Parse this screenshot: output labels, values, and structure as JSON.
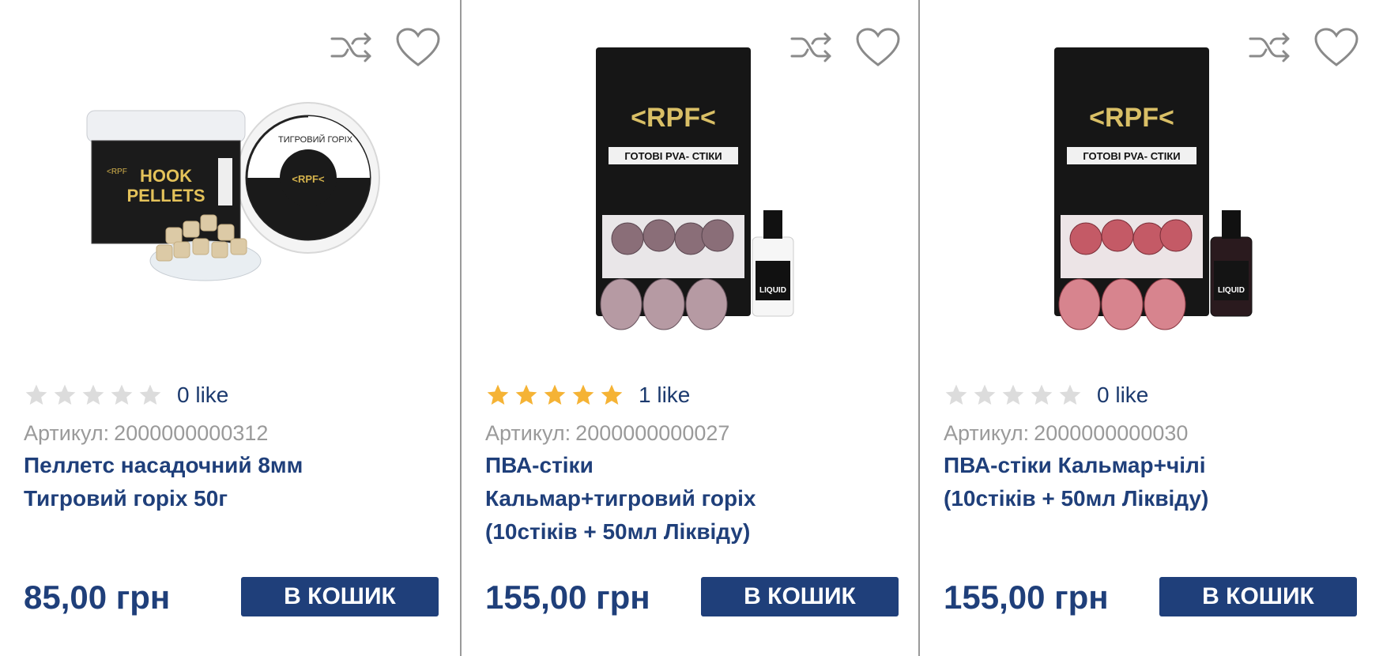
{
  "colors": {
    "brand_blue": "#1f3f7a",
    "star_filled": "#f5b335",
    "star_empty": "#dcdcdc",
    "muted_text": "#9a9a9a"
  },
  "products": [
    {
      "rating": 0,
      "likes": "0 like",
      "sku_label": "Артикул:",
      "sku": "2000000000312",
      "title_lines": [
        "Пеллетс насадочний 8мм",
        "Тигровий горіх 50г"
      ],
      "price": "85,00 грн",
      "buy_label": "В КОШИК",
      "image_labels": {
        "jar_text": "HOOK PELLETS",
        "lid_text": "ТИГРОВИЙ ГОРІХ"
      }
    },
    {
      "rating": 5,
      "likes": "1 like",
      "sku_label": "Артикул:",
      "sku": "2000000000027",
      "title_lines": [
        "ПВА-стіки",
        "Кальмар+тигровий горіх",
        "(10стіків + 50мл Ліквіду)"
      ],
      "price": "155,00 грн",
      "buy_label": "В КОШИК",
      "image_labels": {
        "brand": "<RPF<",
        "bag_text": "ГОТОВІ PVA- СТІКИ",
        "bottle_text": "LIQUID"
      }
    },
    {
      "rating": 0,
      "likes": "0 like",
      "sku_label": "Артикул:",
      "sku": "2000000000030",
      "title_lines": [
        "ПВА-стіки Кальмар+чілі",
        "(10стіків + 50мл Ліквіду)"
      ],
      "price": "155,00 грн",
      "buy_label": "В КОШИК",
      "image_labels": {
        "brand": "<RPF<",
        "bag_text": "ГОТОВІ PVA- СТІКИ",
        "bottle_text": "LIQUID"
      }
    }
  ]
}
